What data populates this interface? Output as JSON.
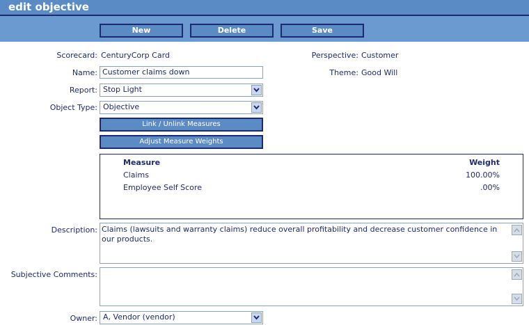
{
  "window": {
    "title": "edit objective"
  },
  "toolbar": {
    "new_label": "New",
    "delete_label": "Delete",
    "save_label": "Save"
  },
  "form": {
    "scorecard_label": "Scorecard:",
    "scorecard_value": "CenturyCorp Card",
    "perspective_label": "Perspective:",
    "perspective_value": "Customer",
    "name_label": "Name:",
    "name_value": "Customer claims down",
    "theme_label": "Theme:",
    "theme_value": "Good Will",
    "report_label": "Report:",
    "report_value": "Stop Light",
    "object_type_label": "Object Type:",
    "object_type_value": "Objective",
    "link_measures_label": "Link / Unlink Measures",
    "adjust_weights_label": "Adjust Measure Weights",
    "description_label": "Description:",
    "description_value": "Claims (lawsuits and warranty claims) reduce overall profitability and decrease customer confidence in our products.",
    "subjective_comments_label": "Subjective Comments:",
    "subjective_comments_value": "",
    "owner_label": "Owner:",
    "owner_value": "A, Vendor (vendor)"
  },
  "measures": {
    "columns": [
      "Measure",
      "Weight"
    ],
    "rows": [
      {
        "measure": "Claims",
        "weight": "100.00%"
      },
      {
        "measure": "Employee Self Score",
        "weight": ".00%"
      }
    ]
  }
}
